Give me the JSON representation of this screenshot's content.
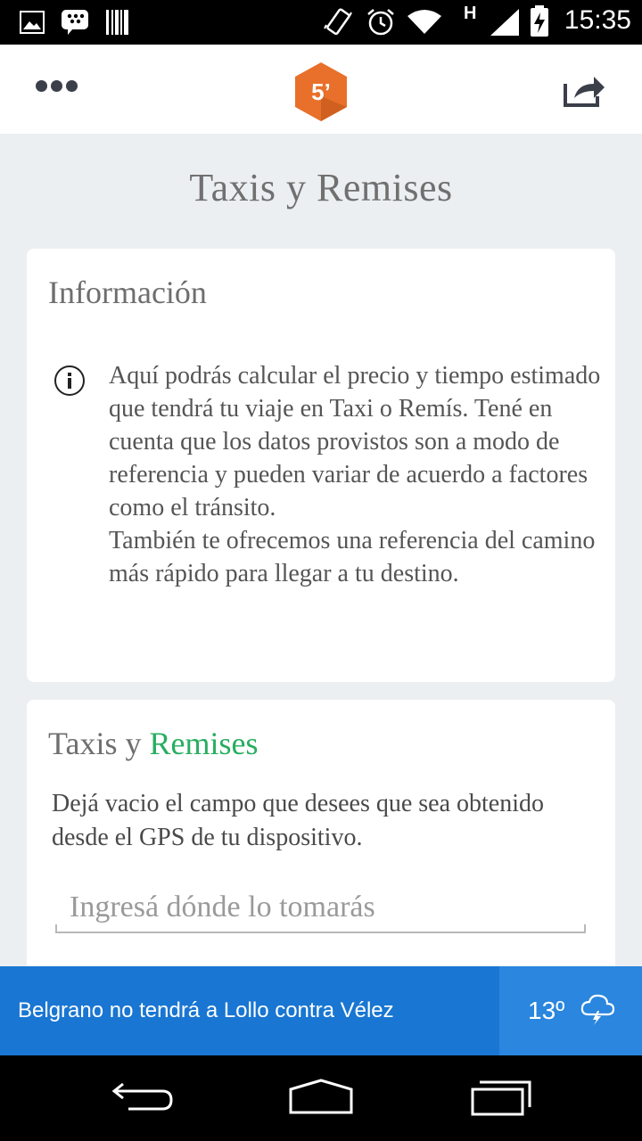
{
  "status_bar": {
    "time": "15:35",
    "icons": [
      "image-icon",
      "bbm-icon",
      "barcode-icon",
      "vibrate-icon",
      "alarm-icon",
      "wifi-icon",
      "hspa-signal-icon",
      "battery-charging-icon"
    ],
    "network_label": "H"
  },
  "app_bar": {
    "logo_text": "5’",
    "logo_color": "#e8702a",
    "icons": [
      "overflow-menu-icon",
      "share-icon"
    ]
  },
  "page": {
    "title": "Taxis y Remises"
  },
  "info_card": {
    "title": "Información",
    "icon": "info-icon",
    "paragraph1": "Aquí podrás calcular el precio y tiempo estimado que tendrá tu viaje en Taxi o Remís. Tené en cuenta que los datos provistos son a modo de referencia y pueden variar de acuerdo a factores como el tránsito.",
    "paragraph2": "También te ofrecemos una referencia del camino más rápido para llegar a tu destino."
  },
  "taxi_card": {
    "title_part1": "Taxis y ",
    "title_part2": "Remises",
    "accent_color": "#27ae60",
    "description": "Dejá vacio el campo que desees que sea obtenido desde el GPS de tu dispositivo.",
    "origin_placeholder": "Ingresá dónde lo tomarás"
  },
  "news_bar": {
    "headline": "Belgrano no tendrá a Lollo contra Vélez",
    "temperature": "13º",
    "weather_icon": "storm-cloud-icon",
    "color": "#1976d2"
  },
  "nav_bar": {
    "icons": [
      "back-icon",
      "home-icon",
      "recents-icon"
    ]
  }
}
